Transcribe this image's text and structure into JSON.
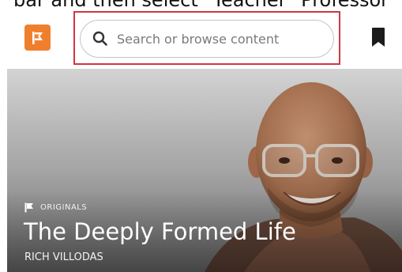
{
  "caption": "bar and then select \"Teacher\" Professor",
  "header": {
    "logo_icon": "flag-logo-icon",
    "brand_color": "#f07f2d",
    "search": {
      "placeholder": "Search or browse content",
      "value": ""
    },
    "bookmark_icon": "bookmark-icon",
    "highlight_color": "#d1373f"
  },
  "hero": {
    "badge": "ORIGINALS",
    "title": "The Deeply Formed Life",
    "author": "RICH VILLODAS"
  }
}
